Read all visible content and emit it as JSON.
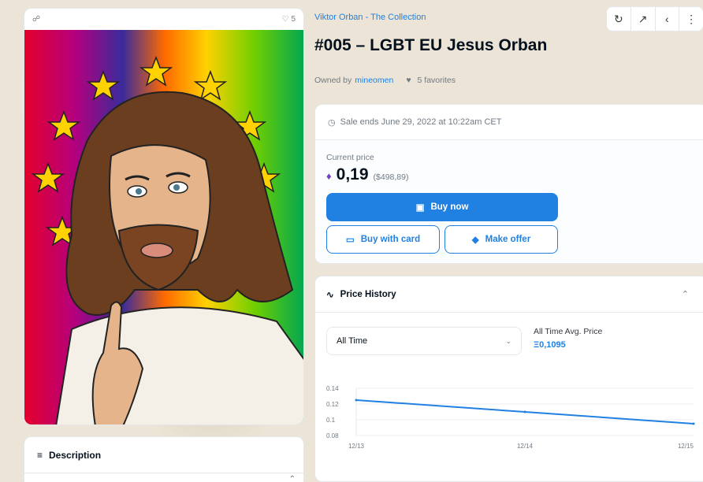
{
  "image_card": {
    "favorite_count": "5"
  },
  "description": {
    "title": "Description"
  },
  "collection": "Viktor Orban - The Collection",
  "title": "#005 – LGBT EU Jesus Orban",
  "owner": {
    "owned_by_label": "Owned by",
    "owner_name": "mineomen",
    "favorites_text": "5 favorites"
  },
  "sale": {
    "ends_text": "Sale ends June 29, 2022 at 10:22am CET",
    "current_price_label": "Current price",
    "price": "0,19",
    "usd_price": "($498,89)",
    "buy_now_label": "Buy now",
    "buy_with_card_label": "Buy with card",
    "make_offer_label": "Make offer"
  },
  "price_history": {
    "title": "Price History",
    "range_selected": "All Time",
    "avg_label": "All Time Avg. Price",
    "avg_value": "Ξ0,1095"
  },
  "colors": {
    "accent": "#2081e2",
    "text": "#04111d",
    "muted": "#707a83"
  },
  "chart_data": {
    "type": "line",
    "x": [
      "12/13",
      "12/14",
      "12/15"
    ],
    "series": [
      {
        "values": [
          0.125,
          0.11,
          0.095
        ]
      }
    ],
    "ylim": [
      0.08,
      0.14
    ],
    "yticks": [
      "0.14",
      "0.12",
      "0.1",
      "0.08"
    ],
    "grid": true,
    "xlabel": "",
    "ylabel": ""
  }
}
